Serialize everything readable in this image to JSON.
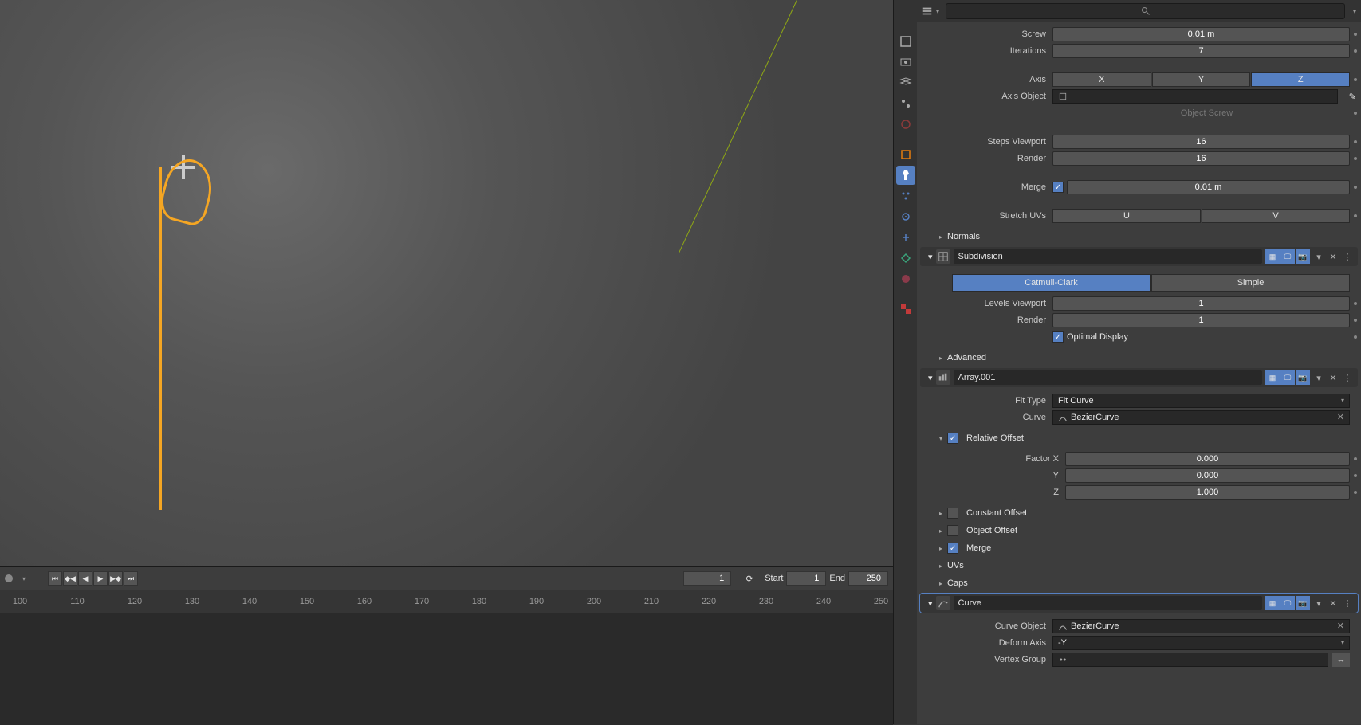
{
  "viewport": {},
  "timeline": {
    "current_frame": "1",
    "start_label": "Start",
    "start_value": "1",
    "end_label": "End",
    "end_value": "250",
    "ticks": [
      "100",
      "110",
      "120",
      "130",
      "140",
      "150",
      "160",
      "170",
      "180",
      "190",
      "200",
      "210",
      "220",
      "230",
      "240",
      "250"
    ]
  },
  "properties": {
    "search_placeholder": "",
    "screw": {
      "screw_label": "Screw",
      "screw_value": "0.01 m",
      "iterations_label": "Iterations",
      "iterations_value": "7",
      "axis_label": "Axis",
      "axis_x": "X",
      "axis_y": "Y",
      "axis_z": "Z",
      "axis_object_label": "Axis Object",
      "axis_object_value": "",
      "object_screw": "Object Screw",
      "steps_viewport_label": "Steps Viewport",
      "steps_viewport_value": "16",
      "render_label": "Render",
      "render_value": "16",
      "merge_label": "Merge",
      "merge_value": "0.01 m",
      "stretch_uvs_label": "Stretch UVs",
      "stretch_u": "U",
      "stretch_v": "V"
    },
    "normals_label": "Normals",
    "subdivision": {
      "name": "Subdivision",
      "catmull": "Catmull-Clark",
      "simple": "Simple",
      "levels_viewport_label": "Levels Viewport",
      "levels_viewport_value": "1",
      "render_label": "Render",
      "render_value": "1",
      "optimal_display": "Optimal Display"
    },
    "advanced_label": "Advanced",
    "array": {
      "name": "Array.001",
      "fit_type_label": "Fit Type",
      "fit_type_value": "Fit Curve",
      "curve_label": "Curve",
      "curve_value": "BezierCurve",
      "relative_offset_label": "Relative Offset",
      "factor_x_label": "Factor X",
      "factor_x_value": "0.000",
      "factor_y_label": "Y",
      "factor_y_value": "0.000",
      "factor_z_label": "Z",
      "factor_z_value": "1.000",
      "constant_offset_label": "Constant Offset",
      "object_offset_label": "Object Offset",
      "merge_label": "Merge",
      "uvs_label": "UVs",
      "caps_label": "Caps"
    },
    "curve": {
      "name": "Curve",
      "curve_object_label": "Curve Object",
      "curve_object_value": "BezierCurve",
      "deform_axis_label": "Deform Axis",
      "deform_axis_value": "-Y",
      "vertex_group_label": "Vertex Group",
      "vertex_group_value": ""
    }
  }
}
